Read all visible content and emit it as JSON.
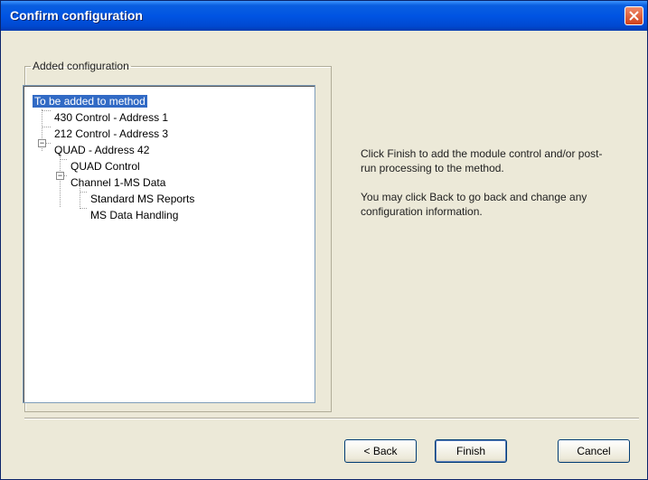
{
  "window": {
    "title": "Confirm configuration"
  },
  "group": {
    "legend": "Added configuration"
  },
  "tree": {
    "items": [
      {
        "label": "To be added to method",
        "selected": true
      },
      {
        "label": "430 Control - Address 1"
      },
      {
        "label": "212 Control - Address 3"
      },
      {
        "label": "QUAD - Address 42",
        "expander": "−"
      },
      {
        "label": "QUAD Control"
      },
      {
        "label": "Channel 1-MS Data",
        "expander": "−"
      },
      {
        "label": "Standard MS Reports"
      },
      {
        "label": "MS Data Handling"
      }
    ]
  },
  "info": {
    "line1": "Click Finish to add the module control and/or post-run processing to the method.",
    "line2": "You may click Back to go back and change any configuration information."
  },
  "buttons": {
    "back": "< Back",
    "finish": "Finish",
    "cancel": "Cancel"
  },
  "colors": {
    "titlebar": "#0054e3",
    "selection": "#316ac5",
    "close": "#d0401a"
  }
}
